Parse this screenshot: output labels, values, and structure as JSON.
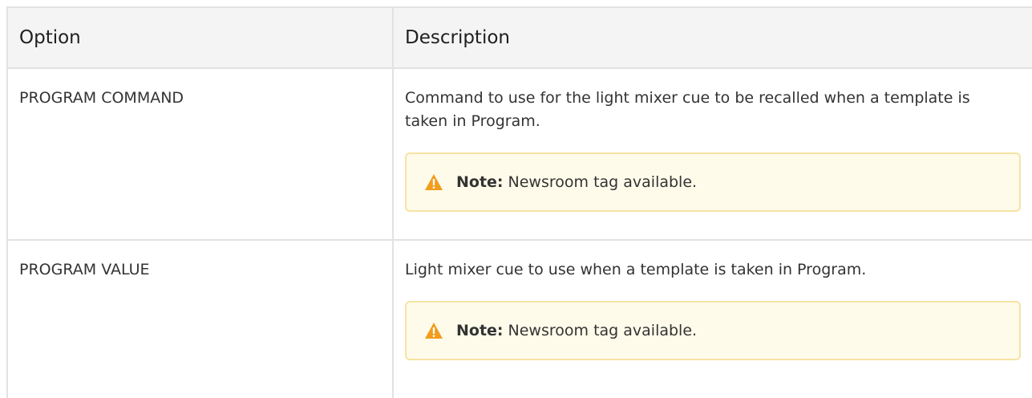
{
  "table": {
    "headers": {
      "option": "Option",
      "description": "Description"
    },
    "rows": [
      {
        "option": "PROGRAM COMMAND",
        "description": "Command to use for the light mixer cue to be recalled when a template is taken in Program.",
        "note_label": "Note:",
        "note_text": "Newsroom tag available."
      },
      {
        "option": "PROGRAM VALUE",
        "description": "Light mixer cue to use when a template is taken in Program.",
        "note_label": "Note:",
        "note_text": "Newsroom tag available."
      }
    ]
  },
  "icons": {
    "note": "warning-triangle-icon"
  },
  "colors": {
    "header_bg": "#f4f4f4",
    "note_bg": "#fffbea",
    "note_border": "#f6e3a3",
    "warning_orange": "#f29d1c"
  }
}
